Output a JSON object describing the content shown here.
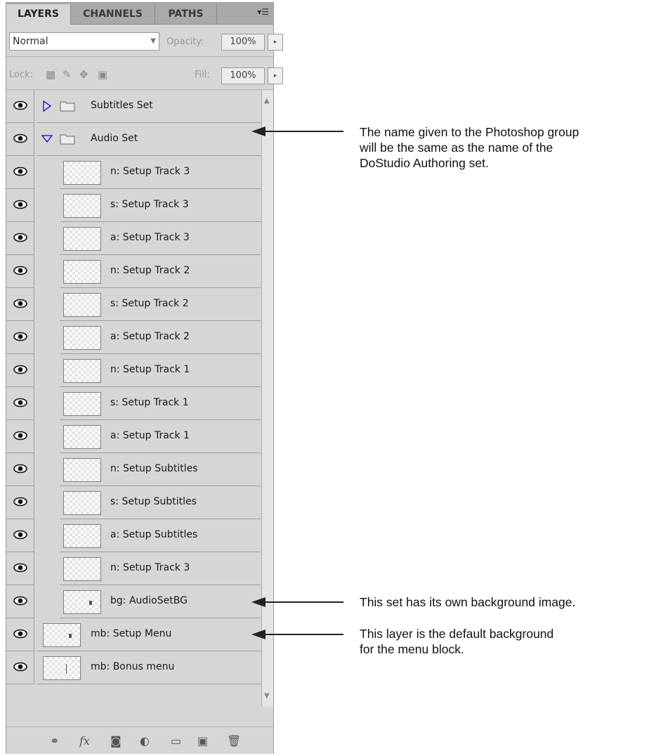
{
  "tabs": [
    {
      "label": "LAYERS",
      "active": true
    },
    {
      "label": "CHANNELS",
      "active": false
    },
    {
      "label": "PATHS",
      "active": false
    }
  ],
  "blend_mode": "Normal",
  "opacity": {
    "label": "Opacity:",
    "value": "100%"
  },
  "lock": {
    "label": "Lock:"
  },
  "fill": {
    "label": "Fill:",
    "value": "100%"
  },
  "layers": [
    {
      "name": "Subtitles Set",
      "type": "group",
      "expanded": false
    },
    {
      "name": "Audio Set",
      "type": "group",
      "expanded": true
    },
    {
      "name": "n: Setup Track 3",
      "type": "layer"
    },
    {
      "name": "s: Setup Track 3",
      "type": "layer"
    },
    {
      "name": "a: Setup Track 3",
      "type": "layer"
    },
    {
      "name": "n: Setup Track 2",
      "type": "layer"
    },
    {
      "name": "s: Setup Track 2",
      "type": "layer"
    },
    {
      "name": "a: Setup Track 2",
      "type": "layer"
    },
    {
      "name": "n: Setup Track 1",
      "type": "layer"
    },
    {
      "name": "s: Setup Track 1",
      "type": "layer"
    },
    {
      "name": "a: Setup Track 1",
      "type": "layer"
    },
    {
      "name": "n: Setup Subtitles",
      "type": "layer"
    },
    {
      "name": "s: Setup Subtitles",
      "type": "layer"
    },
    {
      "name": "a: Setup Subtitles",
      "type": "layer"
    },
    {
      "name": "n: Setup Track 3",
      "type": "layer"
    },
    {
      "name": "bg: AudioSetBG",
      "type": "layer"
    },
    {
      "name": "mb: Setup Menu",
      "type": "layer"
    },
    {
      "name": "mb: Bonus menu",
      "type": "layer"
    }
  ],
  "annotations": [
    {
      "lines": [
        "The name given to the Photoshop group",
        "will be the same as the name of the",
        "DoStudio Authoring set."
      ]
    },
    {
      "lines": [
        "This set has its own background image."
      ]
    },
    {
      "lines": [
        "This layer is the default background",
        "for the menu block."
      ]
    }
  ],
  "icons": {
    "visibility": "eye-icon",
    "collapsed_group": "triangle-right-icon",
    "expanded_group": "triangle-down-icon",
    "group": "folder-icon",
    "bottom_bar": [
      "link-icon",
      "fx-icon",
      "mask-icon",
      "adjustment-icon",
      "new-group-icon",
      "new-layer-icon",
      "trash-icon"
    ]
  }
}
